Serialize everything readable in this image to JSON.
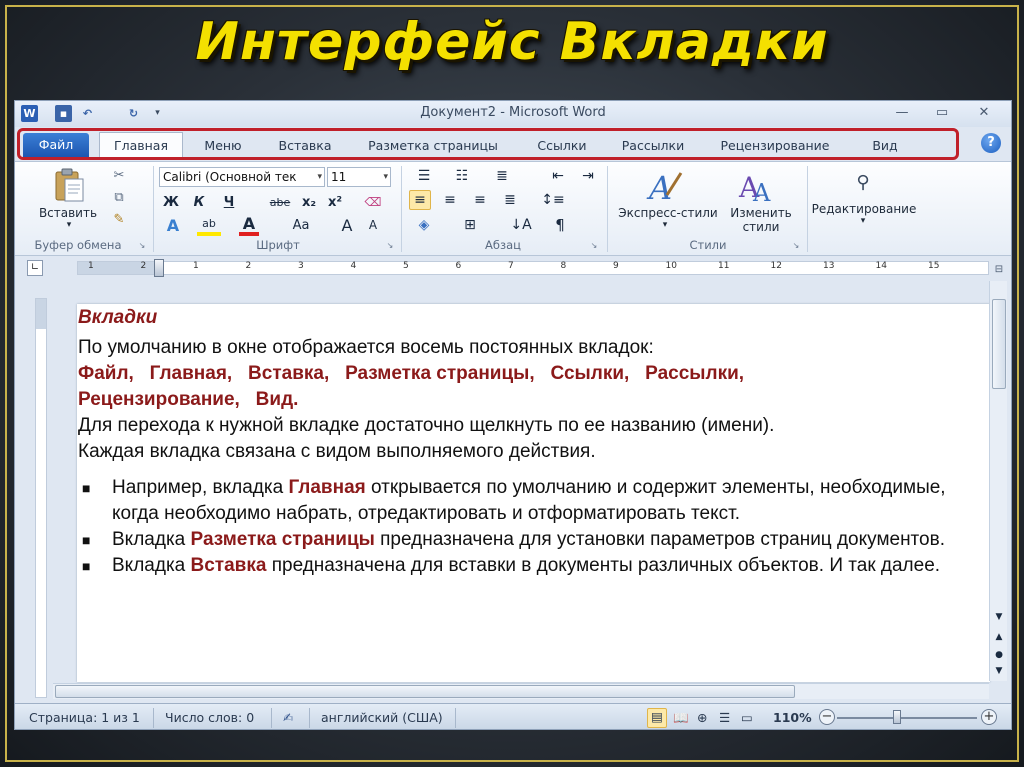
{
  "slide": {
    "title": "Интерфейс  Вкладки"
  },
  "window": {
    "title": "Документ2 - Microsoft Word",
    "quick_access": [
      "word-icon",
      "save-icon",
      "undo-icon",
      "redo-icon",
      "customize-icon"
    ],
    "controls": [
      "minimize",
      "maximize",
      "close"
    ]
  },
  "tabs": [
    {
      "label": "Файл",
      "kind": "file"
    },
    {
      "label": "Главная",
      "kind": "active"
    },
    {
      "label": "Меню",
      "kind": "normal"
    },
    {
      "label": "Вставка",
      "kind": "normal"
    },
    {
      "label": "Разметка страницы",
      "kind": "normal"
    },
    {
      "label": "Ссылки",
      "kind": "normal"
    },
    {
      "label": "Рассылки",
      "kind": "normal"
    },
    {
      "label": "Рецензирование",
      "kind": "normal"
    },
    {
      "label": "Вид",
      "kind": "normal"
    }
  ],
  "ribbon": {
    "clipboard": {
      "label": "Буфер обмена",
      "paste_label": "Вставить"
    },
    "font": {
      "label": "Шрифт",
      "font_name": "Calibri (Основной тек",
      "font_size": "11",
      "bold": "Ж",
      "italic": "К",
      "underline": "Ч",
      "strikethrough": "abe",
      "subscript": "x₂",
      "superscript": "x²",
      "grow": "A",
      "shrink": "A",
      "case": "Aa"
    },
    "paragraph": {
      "label": "Абзац",
      "pilcrow": "¶"
    },
    "styles": {
      "label": "Стили",
      "express_label": "Экспресс-стили",
      "change_label_1": "Изменить",
      "change_label_2": "стили"
    },
    "editing": {
      "label": "Редактирование"
    }
  },
  "ruler": {
    "numbers": [
      "1",
      "2",
      "1",
      "2",
      "3",
      "4",
      "5",
      "6",
      "7",
      "8",
      "9",
      "10",
      "11",
      "12",
      "13",
      "14",
      "15"
    ]
  },
  "document": {
    "heading": "Вкладки",
    "intro": "По умолчанию в окне отображается восемь постоянных вкладок:",
    "tab_list": "Файл,   Главная,   Вставка,   Разметка страницы,   Ссылки,   Рассылки,",
    "tab_list_2": "Рецензирование,   Вид.",
    "line_1": "Для перехода к нужной вкладке достаточно щелкнуть по ее названию (имени).",
    "line_2": "Каждая вкладка связана с видом выполняемого действия.",
    "bullets": [
      {
        "pre": "Например, вкладка ",
        "kw": "Главная",
        "post": " открывается по умолчанию  и содержит элементы, необходимые, когда необходимо набрать, отредактировать и отформатировать текст."
      },
      {
        "pre": "Вкладка ",
        "kw": "Разметка страницы",
        "post": " предназначена для установки параметров страниц документов."
      },
      {
        "pre": " Вкладка ",
        "kw": "Вставка",
        "post": " предназначена для вставки в документы различных объектов. И так далее."
      }
    ]
  },
  "statusbar": {
    "page": "Страница: 1 из 1",
    "words": "Число слов: 0",
    "language": "английский (США)",
    "zoom": "110%",
    "zoom_minus": "−",
    "zoom_plus": "+"
  },
  "colors": {
    "title": "#f4e000",
    "highlight_red": "#c0202a",
    "keyword": "#8b1a1a",
    "file_tab": "#1d56b0"
  }
}
